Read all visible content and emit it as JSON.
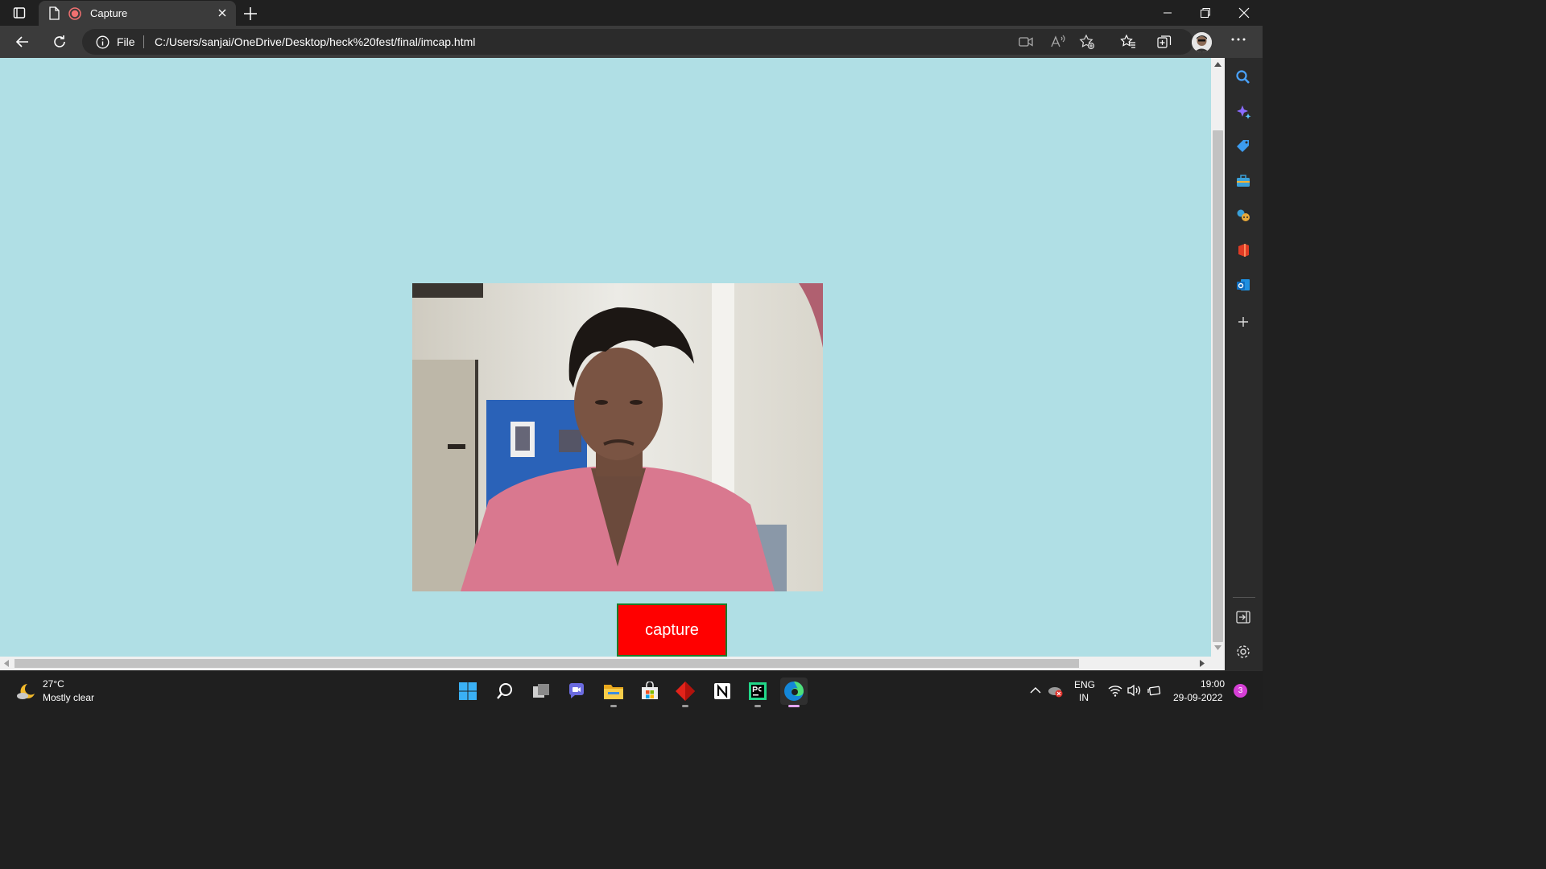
{
  "browser": {
    "tab_title": "Capture",
    "site_label": "File",
    "url": "C:/Users/sanjai/OneDrive/Desktop/heck%20fest/final/imcap.html"
  },
  "page": {
    "background_color": "#b0dfe5",
    "capture_button_label": "capture",
    "capture_button_color": "#ff0000",
    "video_feed": "webcam-preview"
  },
  "sidebar": {
    "icons": [
      "search-icon",
      "copilot-icon",
      "shopping-tag-icon",
      "tools-briefcase-icon",
      "games-icon",
      "office-icon",
      "outlook-icon",
      "add-icon",
      "hide-sidebar-icon",
      "settings-icon"
    ]
  },
  "taskbar": {
    "weather_temp": "27°C",
    "weather_desc": "Mostly clear",
    "apps": [
      "start-icon",
      "search-icon",
      "task-view-icon",
      "chat-icon",
      "file-explorer-icon",
      "store-icon",
      "git-app-icon",
      "notion-icon",
      "pycharm-icon",
      "edge-icon"
    ],
    "lang_line1": "ENG",
    "lang_line2": "IN",
    "time": "19:00",
    "date": "29-09-2022",
    "notification_count": "3"
  }
}
